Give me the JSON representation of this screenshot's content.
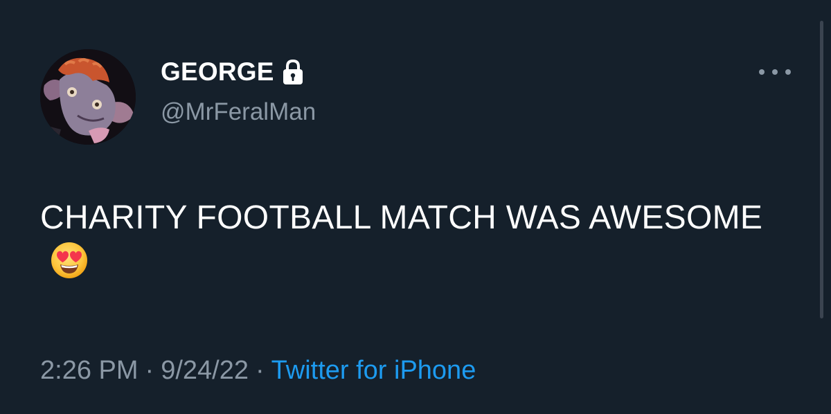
{
  "user": {
    "display_name": "GEORGE",
    "handle": "@MrFeralMan",
    "protected": true,
    "avatar_icon": "profile-avatar"
  },
  "tweet": {
    "text": "CHARITY FOOTBALL MATCH WAS AWESOME",
    "emoji": "😍",
    "time": "2:26 PM",
    "date": "9/24/22",
    "separator": "·",
    "source": "Twitter for iPhone"
  },
  "menu": {
    "icon": "more-icon"
  },
  "colors": {
    "background": "#15202b",
    "text": "#ffffff",
    "muted": "#8b98a5",
    "link": "#1d9bf0"
  }
}
